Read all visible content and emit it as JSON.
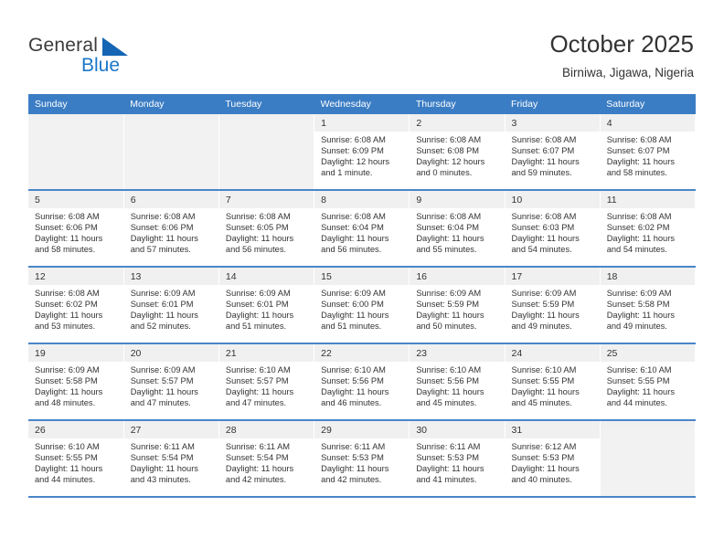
{
  "brand": {
    "name_top": "General",
    "name_bottom": "Blue",
    "triangle_color": "#1466b4",
    "blue_color": "#1a77c9"
  },
  "header": {
    "title": "October 2025",
    "subtitle": "Birniwa, Jigawa, Nigeria"
  },
  "colors": {
    "header_row_bg": "#3b7dc4",
    "row_divider": "#4a86c8",
    "daynum_bg": "#f0f0f0",
    "text": "#333333"
  },
  "weekdays": [
    "Sunday",
    "Monday",
    "Tuesday",
    "Wednesday",
    "Thursday",
    "Friday",
    "Saturday"
  ],
  "weeks": [
    [
      {
        "blank": true
      },
      {
        "blank": true
      },
      {
        "blank": true
      },
      {
        "day": "1",
        "sunrise": "Sunrise: 6:08 AM",
        "sunset": "Sunset: 6:09 PM",
        "daylight": "Daylight: 12 hours and 1 minute."
      },
      {
        "day": "2",
        "sunrise": "Sunrise: 6:08 AM",
        "sunset": "Sunset: 6:08 PM",
        "daylight": "Daylight: 12 hours and 0 minutes."
      },
      {
        "day": "3",
        "sunrise": "Sunrise: 6:08 AM",
        "sunset": "Sunset: 6:07 PM",
        "daylight": "Daylight: 11 hours and 59 minutes."
      },
      {
        "day": "4",
        "sunrise": "Sunrise: 6:08 AM",
        "sunset": "Sunset: 6:07 PM",
        "daylight": "Daylight: 11 hours and 58 minutes."
      }
    ],
    [
      {
        "day": "5",
        "sunrise": "Sunrise: 6:08 AM",
        "sunset": "Sunset: 6:06 PM",
        "daylight": "Daylight: 11 hours and 58 minutes."
      },
      {
        "day": "6",
        "sunrise": "Sunrise: 6:08 AM",
        "sunset": "Sunset: 6:06 PM",
        "daylight": "Daylight: 11 hours and 57 minutes."
      },
      {
        "day": "7",
        "sunrise": "Sunrise: 6:08 AM",
        "sunset": "Sunset: 6:05 PM",
        "daylight": "Daylight: 11 hours and 56 minutes."
      },
      {
        "day": "8",
        "sunrise": "Sunrise: 6:08 AM",
        "sunset": "Sunset: 6:04 PM",
        "daylight": "Daylight: 11 hours and 56 minutes."
      },
      {
        "day": "9",
        "sunrise": "Sunrise: 6:08 AM",
        "sunset": "Sunset: 6:04 PM",
        "daylight": "Daylight: 11 hours and 55 minutes."
      },
      {
        "day": "10",
        "sunrise": "Sunrise: 6:08 AM",
        "sunset": "Sunset: 6:03 PM",
        "daylight": "Daylight: 11 hours and 54 minutes."
      },
      {
        "day": "11",
        "sunrise": "Sunrise: 6:08 AM",
        "sunset": "Sunset: 6:02 PM",
        "daylight": "Daylight: 11 hours and 54 minutes."
      }
    ],
    [
      {
        "day": "12",
        "sunrise": "Sunrise: 6:08 AM",
        "sunset": "Sunset: 6:02 PM",
        "daylight": "Daylight: 11 hours and 53 minutes."
      },
      {
        "day": "13",
        "sunrise": "Sunrise: 6:09 AM",
        "sunset": "Sunset: 6:01 PM",
        "daylight": "Daylight: 11 hours and 52 minutes."
      },
      {
        "day": "14",
        "sunrise": "Sunrise: 6:09 AM",
        "sunset": "Sunset: 6:01 PM",
        "daylight": "Daylight: 11 hours and 51 minutes."
      },
      {
        "day": "15",
        "sunrise": "Sunrise: 6:09 AM",
        "sunset": "Sunset: 6:00 PM",
        "daylight": "Daylight: 11 hours and 51 minutes."
      },
      {
        "day": "16",
        "sunrise": "Sunrise: 6:09 AM",
        "sunset": "Sunset: 5:59 PM",
        "daylight": "Daylight: 11 hours and 50 minutes."
      },
      {
        "day": "17",
        "sunrise": "Sunrise: 6:09 AM",
        "sunset": "Sunset: 5:59 PM",
        "daylight": "Daylight: 11 hours and 49 minutes."
      },
      {
        "day": "18",
        "sunrise": "Sunrise: 6:09 AM",
        "sunset": "Sunset: 5:58 PM",
        "daylight": "Daylight: 11 hours and 49 minutes."
      }
    ],
    [
      {
        "day": "19",
        "sunrise": "Sunrise: 6:09 AM",
        "sunset": "Sunset: 5:58 PM",
        "daylight": "Daylight: 11 hours and 48 minutes."
      },
      {
        "day": "20",
        "sunrise": "Sunrise: 6:09 AM",
        "sunset": "Sunset: 5:57 PM",
        "daylight": "Daylight: 11 hours and 47 minutes."
      },
      {
        "day": "21",
        "sunrise": "Sunrise: 6:10 AM",
        "sunset": "Sunset: 5:57 PM",
        "daylight": "Daylight: 11 hours and 47 minutes."
      },
      {
        "day": "22",
        "sunrise": "Sunrise: 6:10 AM",
        "sunset": "Sunset: 5:56 PM",
        "daylight": "Daylight: 11 hours and 46 minutes."
      },
      {
        "day": "23",
        "sunrise": "Sunrise: 6:10 AM",
        "sunset": "Sunset: 5:56 PM",
        "daylight": "Daylight: 11 hours and 45 minutes."
      },
      {
        "day": "24",
        "sunrise": "Sunrise: 6:10 AM",
        "sunset": "Sunset: 5:55 PM",
        "daylight": "Daylight: 11 hours and 45 minutes."
      },
      {
        "day": "25",
        "sunrise": "Sunrise: 6:10 AM",
        "sunset": "Sunset: 5:55 PM",
        "daylight": "Daylight: 11 hours and 44 minutes."
      }
    ],
    [
      {
        "day": "26",
        "sunrise": "Sunrise: 6:10 AM",
        "sunset": "Sunset: 5:55 PM",
        "daylight": "Daylight: 11 hours and 44 minutes."
      },
      {
        "day": "27",
        "sunrise": "Sunrise: 6:11 AM",
        "sunset": "Sunset: 5:54 PM",
        "daylight": "Daylight: 11 hours and 43 minutes."
      },
      {
        "day": "28",
        "sunrise": "Sunrise: 6:11 AM",
        "sunset": "Sunset: 5:54 PM",
        "daylight": "Daylight: 11 hours and 42 minutes."
      },
      {
        "day": "29",
        "sunrise": "Sunrise: 6:11 AM",
        "sunset": "Sunset: 5:53 PM",
        "daylight": "Daylight: 11 hours and 42 minutes."
      },
      {
        "day": "30",
        "sunrise": "Sunrise: 6:11 AM",
        "sunset": "Sunset: 5:53 PM",
        "daylight": "Daylight: 11 hours and 41 minutes."
      },
      {
        "day": "31",
        "sunrise": "Sunrise: 6:12 AM",
        "sunset": "Sunset: 5:53 PM",
        "daylight": "Daylight: 11 hours and 40 minutes."
      },
      {
        "blank": true
      }
    ]
  ]
}
